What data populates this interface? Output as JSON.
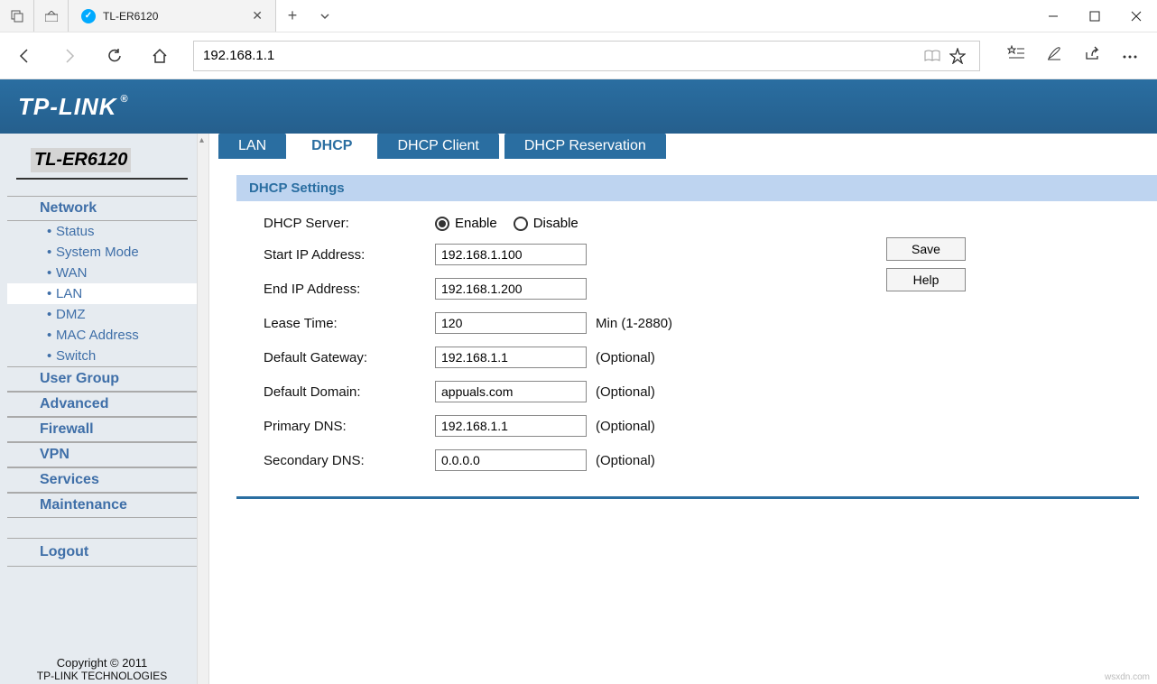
{
  "browser": {
    "tab_title": "TL-ER6120",
    "url": "192.168.1.1"
  },
  "logo": "TP-LINK",
  "model": "TL-ER6120",
  "sidebar": {
    "sections": [
      {
        "label": "Network",
        "items": [
          "Status",
          "System Mode",
          "WAN",
          "LAN",
          "DMZ",
          "MAC Address",
          "Switch"
        ],
        "active_item": "LAN"
      },
      {
        "label": "User Group"
      },
      {
        "label": "Advanced"
      },
      {
        "label": "Firewall"
      },
      {
        "label": "VPN"
      },
      {
        "label": "Services"
      },
      {
        "label": "Maintenance"
      }
    ],
    "logout": "Logout"
  },
  "copyright": {
    "line1": "Copyright © 2011",
    "line2": "TP-LINK TECHNOLOGIES"
  },
  "tabs": [
    "LAN",
    "DHCP",
    "DHCP Client",
    "DHCP Reservation"
  ],
  "active_tab": "DHCP",
  "panel": {
    "title": "DHCP Settings",
    "dhcp_server_label": "DHCP Server:",
    "enable_label": "Enable",
    "disable_label": "Disable",
    "dhcp_server_value": "Enable",
    "rows": {
      "start_ip": {
        "label": "Start IP Address:",
        "value": "192.168.1.100",
        "suffix": ""
      },
      "end_ip": {
        "label": "End IP Address:",
        "value": "192.168.1.200",
        "suffix": ""
      },
      "lease_time": {
        "label": "Lease Time:",
        "value": "120",
        "suffix": "Min (1-2880)"
      },
      "default_gateway": {
        "label": "Default Gateway:",
        "value": "192.168.1.1",
        "suffix": "(Optional)"
      },
      "default_domain": {
        "label": "Default Domain:",
        "value": "appuals.com",
        "suffix": "(Optional)"
      },
      "primary_dns": {
        "label": "Primary DNS:",
        "value": "192.168.1.1",
        "suffix": "(Optional)"
      },
      "secondary_dns": {
        "label": "Secondary DNS:",
        "value": "0.0.0.0",
        "suffix": "(Optional)"
      }
    },
    "save_label": "Save",
    "help_label": "Help"
  },
  "watermark": "wsxdn.com"
}
